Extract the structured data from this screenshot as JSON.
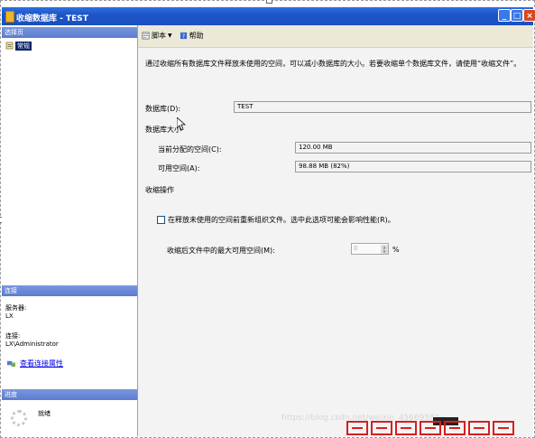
{
  "window": {
    "title": "收缩数据库 - TEST",
    "buttons": [
      "_",
      "□",
      "×"
    ]
  },
  "left": {
    "select_page_header": "选择页",
    "page_general": "常规",
    "connection_header": "连接",
    "server_label": "服务器:",
    "server_value": "LX",
    "connection_label": "连接:",
    "connection_value": "LX\\Administrator",
    "view_connection_props": "查看连接属性",
    "progress_header": "进度",
    "progress_status": "就绪"
  },
  "toolbar": {
    "script_label": "脚本",
    "help_label": "帮助"
  },
  "main": {
    "description": "通过收缩所有数据库文件释放未使用的空间，可以减小数据库的大小。若要收缩单个数据库文件，请使用“收缩文件”。",
    "database_label": "数据库(D):",
    "database_value": "TEST",
    "db_size_label": "数据库大小",
    "allocated_label": "当前分配的空间(C):",
    "allocated_value": "120.00 MB",
    "available_label": "可用空间(A):",
    "available_value": "98.88 MB (82%)",
    "shrink_ops_label": "收缩操作",
    "reorganize_label": "在释放未使用的空间前重新组织文件。选中此选项可能会影响性能(R)。",
    "reorganize_checked": false,
    "max_free_label": "收缩后文件中的最大可用空间(M):",
    "max_free_value": "0",
    "max_free_unit": "%"
  },
  "watermark": "https://blog.csdn.net/weixin_45669581"
}
